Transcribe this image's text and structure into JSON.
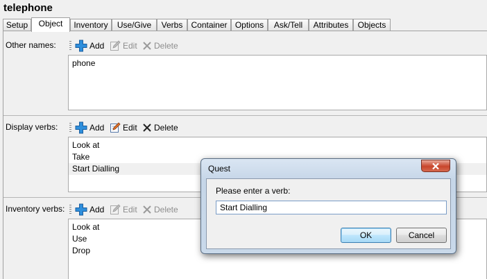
{
  "object_name": "telephone",
  "tabs": [
    {
      "label": "Setup",
      "active": false
    },
    {
      "label": "Object",
      "active": true
    },
    {
      "label": "Inventory",
      "active": false
    },
    {
      "label": "Use/Give",
      "active": false
    },
    {
      "label": "Verbs",
      "active": false
    },
    {
      "label": "Container",
      "active": false
    },
    {
      "label": "Options",
      "active": false
    },
    {
      "label": "Ask/Tell",
      "active": false
    },
    {
      "label": "Attributes",
      "active": false
    },
    {
      "label": "Objects",
      "active": false
    }
  ],
  "toolbar": {
    "add": "Add",
    "edit": "Edit",
    "delete": "Delete"
  },
  "sections": {
    "other_names": {
      "label": "Other names:",
      "items": [
        "phone"
      ]
    },
    "display_verbs": {
      "label": "Display verbs:",
      "items": [
        "Look at",
        "Take",
        "Start Dialling"
      ]
    },
    "inventory_verbs": {
      "label": "Inventory verbs:",
      "items": [
        "Look at",
        "Use",
        "Drop"
      ]
    }
  },
  "dialog": {
    "title": "Quest",
    "prompt": "Please enter a verb:",
    "input_value": "Start Dialling",
    "ok_label": "OK",
    "cancel_label": "Cancel"
  },
  "colors": {
    "add_icon": "#2f8fdc",
    "close_button": "#c8452c"
  }
}
